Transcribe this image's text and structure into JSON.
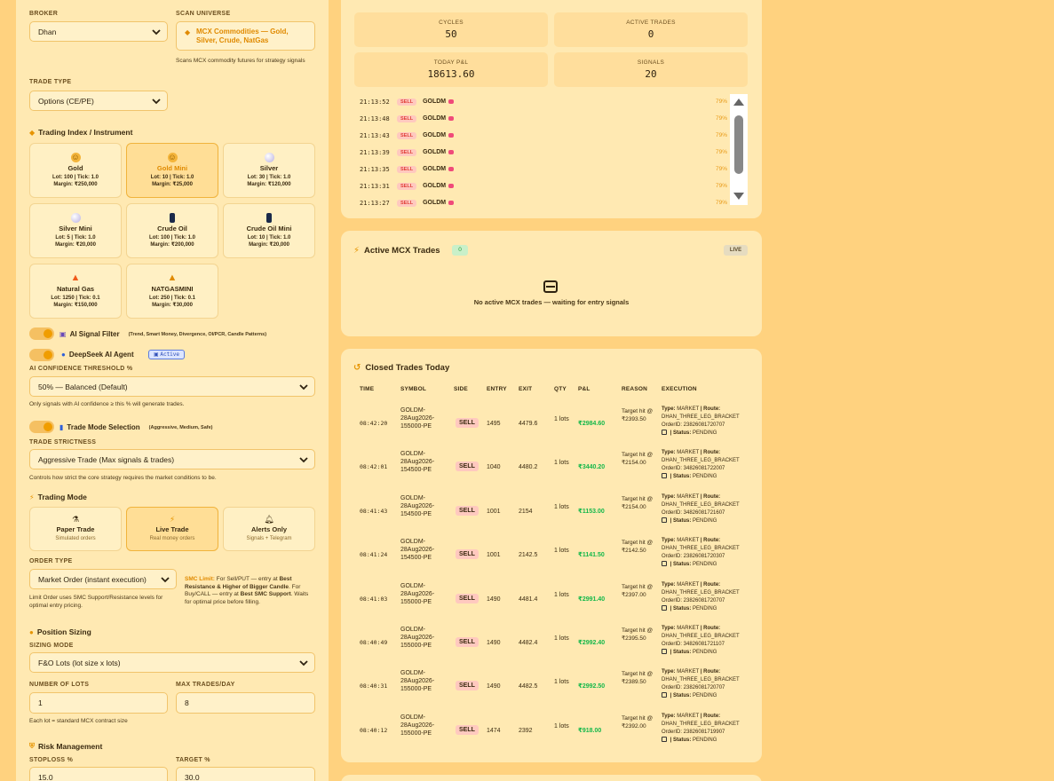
{
  "left": {
    "broker_label": "BROKER",
    "broker_value": "Dhan",
    "scan_label": "SCAN UNIVERSE",
    "scan_value": "MCX Commodities — Gold, Silver, Crude, NatGas",
    "scan_help": "Scans MCX commodity futures for strategy signals",
    "trade_type_label": "TRADE TYPE",
    "trade_type_value": "Options (CE/PE)",
    "instrument_title": "Trading Index / Instrument",
    "instruments": [
      {
        "name": "Gold",
        "lot": "Lot: 100 | Tick: 1.0",
        "margin": "Margin: ₹250,000",
        "icon": "gold-coin-icon"
      },
      {
        "name": "Gold Mini",
        "lot": "Lot: 10 | Tick: 1.0",
        "margin": "Margin: ₹25,000",
        "icon": "gold-coin-icon"
      },
      {
        "name": "Silver",
        "lot": "Lot: 30 | Tick: 1.0",
        "margin": "Margin: ₹120,000",
        "icon": "silver-coin-icon"
      },
      {
        "name": "Silver Mini",
        "lot": "Lot: 5 | Tick: 1.0",
        "margin": "Margin: ₹20,000",
        "icon": "silver-coin-icon"
      },
      {
        "name": "Crude Oil",
        "lot": "Lot: 100 | Tick: 1.0",
        "margin": "Margin: ₹200,000",
        "icon": "oil-barrel-icon"
      },
      {
        "name": "Crude Oil Mini",
        "lot": "Lot: 10 | Tick: 1.0",
        "margin": "Margin: ₹20,000",
        "icon": "oil-barrel-icon"
      },
      {
        "name": "Natural Gas",
        "lot": "Lot: 1250 | Tick: 0.1",
        "margin": "Margin: ₹150,000",
        "icon": "flame-icon"
      },
      {
        "name": "NATGASMINI",
        "lot": "Lot: 250 | Tick: 0.1",
        "margin": "Margin: ₹30,000",
        "icon": "flame-icon"
      }
    ],
    "ai_filter_label": "AI Signal Filter",
    "ai_filter_note": "(Trend, Smart Money, Divergence, OI/PCR, Candle Patterns)",
    "deepseek_label": "DeepSeek AI Agent",
    "deepseek_badge": "Active",
    "confidence_label": "AI CONFIDENCE THRESHOLD %",
    "confidence_value": "50% — Balanced (Default)",
    "confidence_help": "Only signals with AI confidence ≥ this % will generate trades.",
    "mode_selection_label": "Trade Mode Selection",
    "mode_selection_note": "(Aggressive, Medium, Safe)",
    "strictness_label": "TRADE STRICTNESS",
    "strictness_value": "Aggressive Trade (Max signals & trades)",
    "strictness_help": "Controls how strict the core strategy requires the market conditions to be.",
    "trading_mode_title": "Trading Mode",
    "modes": [
      {
        "name": "Paper Trade",
        "sub": "Simulated orders"
      },
      {
        "name": "Live Trade",
        "sub": "Real money orders"
      },
      {
        "name": "Alerts Only",
        "sub": "Signals + Telegram"
      }
    ],
    "order_type_label": "ORDER TYPE",
    "order_type_value": "Market Order (instant execution)",
    "order_help": "Limit Order uses SMC Support/Resistance levels for optimal entry pricing.",
    "smc_title": "SMC Limit:",
    "smc_text_1": " For Sell/PUT — entry at ",
    "smc_text_2": "Best Resistance & Higher of Bigger Candle",
    "smc_text_3": ". For Buy/CALL — entry at ",
    "smc_text_4": "Best SMC Support",
    "smc_text_5": ". Waits for optimal price before filling.",
    "position_title": "Position Sizing",
    "sizing_label": "SIZING MODE",
    "sizing_value": "F&O Lots (lot size x lots)",
    "lots_label": "NUMBER OF LOTS",
    "lots_value": "1",
    "max_trades_label": "MAX TRADES/DAY",
    "max_trades_value": "8",
    "lots_help": "Each lot = standard MCX contract size",
    "risk_title": "Risk Management",
    "stoploss_label": "STOPLOSS %",
    "stoploss_value": "15.0",
    "target_label": "TARGET %",
    "target_value": "30.0"
  },
  "stats": [
    {
      "label": "CYCLES",
      "value": "50"
    },
    {
      "label": "ACTIVE TRADES",
      "value": "0"
    },
    {
      "label": "TODAY P&L",
      "value": "18613.60"
    },
    {
      "label": "SIGNALS",
      "value": "20"
    }
  ],
  "signal_log": [
    {
      "time": "21:13:52",
      "side": "SELL",
      "symbol": "GOLDM",
      "pct": "79%"
    },
    {
      "time": "21:13:48",
      "side": "SELL",
      "symbol": "GOLDM",
      "pct": "79%"
    },
    {
      "time": "21:13:43",
      "side": "SELL",
      "symbol": "GOLDM",
      "pct": "79%"
    },
    {
      "time": "21:13:39",
      "side": "SELL",
      "symbol": "GOLDM",
      "pct": "79%"
    },
    {
      "time": "21:13:35",
      "side": "SELL",
      "symbol": "GOLDM",
      "pct": "79%"
    },
    {
      "time": "21:13:31",
      "side": "SELL",
      "symbol": "GOLDM",
      "pct": "79%"
    },
    {
      "time": "21:13:27",
      "side": "SELL",
      "symbol": "GOLDM",
      "pct": "79%"
    }
  ],
  "active": {
    "title": "Active MCX Trades",
    "count": "0",
    "live": "LIVE",
    "empty": "No active MCX trades — waiting for entry signals"
  },
  "closed": {
    "title": "Closed Trades Today",
    "headers": [
      "TIME",
      "SYMBOL",
      "SIDE",
      "ENTRY",
      "EXIT",
      "QTY",
      "P&L",
      "REASON",
      "EXECUTION"
    ],
    "rows": [
      {
        "time": "08:42:20",
        "symbol": "GOLDM-28Aug2026-155000-PE",
        "side": "SELL",
        "entry": "1495",
        "exit": "4479.6",
        "qty": "1 lots",
        "pnl": "₹2984.60",
        "reason": "Target hit @ ₹2393.50",
        "order_id": "OrderID: 23826081720707"
      },
      {
        "time": "08:42:01",
        "symbol": "GOLDM-28Aug2026-154500-PE",
        "side": "SELL",
        "entry": "1040",
        "exit": "4480.2",
        "qty": "1 lots",
        "pnl": "₹3440.20",
        "reason": "Target hit @ ₹2154.00",
        "order_id": "OrderID: 34826081722007"
      },
      {
        "time": "08:41:43",
        "symbol": "GOLDM-28Aug2026-154500-PE",
        "side": "SELL",
        "entry": "1001",
        "exit": "2154",
        "qty": "1 lots",
        "pnl": "₹1153.00",
        "reason": "Target hit @ ₹2154.00",
        "order_id": "OrderID: 34826081721607"
      },
      {
        "time": "08:41:24",
        "symbol": "GOLDM-28Aug2026-154500-PE",
        "side": "SELL",
        "entry": "1001",
        "exit": "2142.5",
        "qty": "1 lots",
        "pnl": "₹1141.50",
        "reason": "Target hit @ ₹2142.50",
        "order_id": "OrderID: 23826081720307"
      },
      {
        "time": "08:41:03",
        "symbol": "GOLDM-28Aug2026-155000-PE",
        "side": "SELL",
        "entry": "1490",
        "exit": "4481.4",
        "qty": "1 lots",
        "pnl": "₹2991.40",
        "reason": "Target hit @ ₹2397.00",
        "order_id": "OrderID: 23826081720707"
      },
      {
        "time": "08:40:49",
        "symbol": "GOLDM-28Aug2026-155000-PE",
        "side": "SELL",
        "entry": "1490",
        "exit": "4482.4",
        "qty": "1 lots",
        "pnl": "₹2992.40",
        "reason": "Target hit @ ₹2395.50",
        "order_id": "OrderID: 34826081721107"
      },
      {
        "time": "08:40:31",
        "symbol": "GOLDM-28Aug2026-155000-PE",
        "side": "SELL",
        "entry": "1490",
        "exit": "4482.5",
        "qty": "1 lots",
        "pnl": "₹2992.50",
        "reason": "Target hit @ ₹2389.50",
        "order_id": "OrderID: 23826081720707"
      },
      {
        "time": "08:40:12",
        "symbol": "GOLDM-28Aug2026-155000-PE",
        "side": "SELL",
        "entry": "1474",
        "exit": "2392",
        "qty": "1 lots",
        "pnl": "₹918.00",
        "reason": "Target hit @ ₹2392.00",
        "order_id": "OrderID: 23826081719907"
      }
    ],
    "exec_type_label": "Type:",
    "exec_type": "MARKET",
    "exec_route_label": "| Route:",
    "exec_route": "DHAN_THREE_LEG_BRACKET",
    "exec_status_label": "| Status:",
    "exec_status": "PENDING"
  },
  "colors": {
    "accent": "#e69400",
    "profit": "#14b84a",
    "sell": "#e0413a",
    "panel": "#ffe9b2",
    "background": "#ffd27f"
  }
}
